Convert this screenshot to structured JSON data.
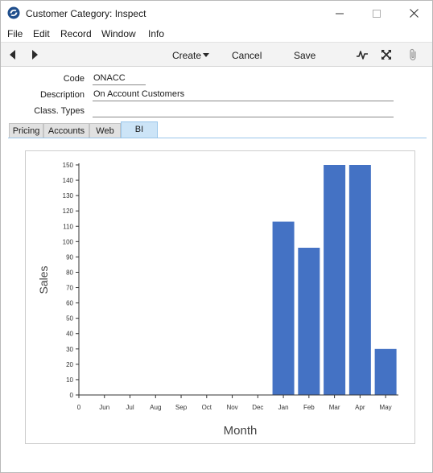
{
  "window": {
    "title": "Customer Category: Inspect"
  },
  "menu": {
    "items": [
      "File",
      "Edit",
      "Record",
      "Window",
      "Info"
    ]
  },
  "toolbar": {
    "create_label": "Create",
    "cancel_label": "Cancel",
    "save_label": "Save"
  },
  "form": {
    "code_label": "Code",
    "code_value": "ONACC",
    "description_label": "Description",
    "description_value": "On Account Customers",
    "class_types_label": "Class. Types",
    "class_types_value": ""
  },
  "tabs": [
    {
      "label": "Pricing",
      "active": false
    },
    {
      "label": "Accounts",
      "active": false
    },
    {
      "label": "Web",
      "active": false
    },
    {
      "label": "BI",
      "active": true
    }
  ],
  "chart_data": {
    "type": "bar",
    "categories": [
      "0",
      "Jun",
      "Jul",
      "Aug",
      "Sep",
      "Oct",
      "Nov",
      "Dec",
      "Jan",
      "Feb",
      "Mar",
      "Apr",
      "May"
    ],
    "values": [
      0,
      0,
      0,
      0,
      0,
      0,
      0,
      0,
      113,
      96,
      150,
      150,
      30
    ],
    "xlabel": "Month",
    "ylabel": "Sales",
    "ylim": [
      0,
      150
    ],
    "yticks": [
      0,
      10,
      20,
      30,
      40,
      50,
      60,
      70,
      80,
      90,
      100,
      110,
      120,
      130,
      140,
      150
    ],
    "color": "#4472c4",
    "grid": false
  }
}
